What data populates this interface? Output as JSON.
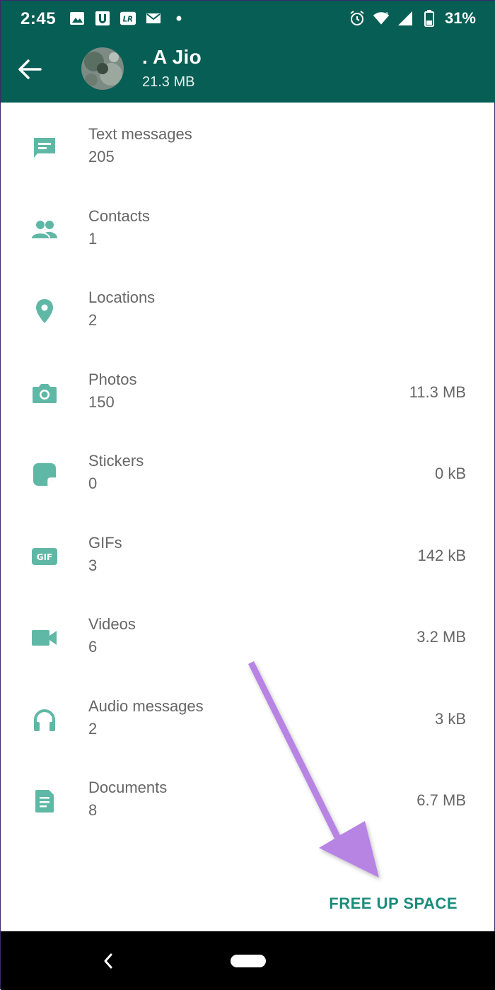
{
  "status_bar": {
    "time": "2:45",
    "battery": "31%",
    "icons_left": [
      "image-icon",
      "u-app-icon",
      "lr-app-icon",
      "email-icon",
      "dot-icon"
    ],
    "icons_right": [
      "alarm-icon",
      "wifi-icon",
      "signal-icon",
      "battery-icon"
    ]
  },
  "toolbar": {
    "title": ". A Jio",
    "subtitle": "21.3 MB"
  },
  "colors": {
    "header": "#075e54",
    "icon": "#5fb8a5",
    "accent": "#1a8c7a",
    "text_secondary": "#666666"
  },
  "items": [
    {
      "label": "Text messages",
      "count": "205",
      "size": "",
      "icon": "message-icon"
    },
    {
      "label": "Contacts",
      "count": "1",
      "size": "",
      "icon": "contacts-icon"
    },
    {
      "label": "Locations",
      "count": "2",
      "size": "",
      "icon": "location-icon"
    },
    {
      "label": "Photos",
      "count": "150",
      "size": "11.3 MB",
      "icon": "camera-icon"
    },
    {
      "label": "Stickers",
      "count": "0",
      "size": "0 kB",
      "icon": "sticker-icon"
    },
    {
      "label": "GIFs",
      "count": "3",
      "size": "142 kB",
      "icon": "gif-icon"
    },
    {
      "label": "Videos",
      "count": "6",
      "size": "3.2 MB",
      "icon": "video-icon"
    },
    {
      "label": "Audio messages",
      "count": "2",
      "size": "3 kB",
      "icon": "headphones-icon"
    },
    {
      "label": "Documents",
      "count": "8",
      "size": "6.7 MB",
      "icon": "document-icon"
    }
  ],
  "action": {
    "free_up_label": "FREE UP SPACE"
  }
}
